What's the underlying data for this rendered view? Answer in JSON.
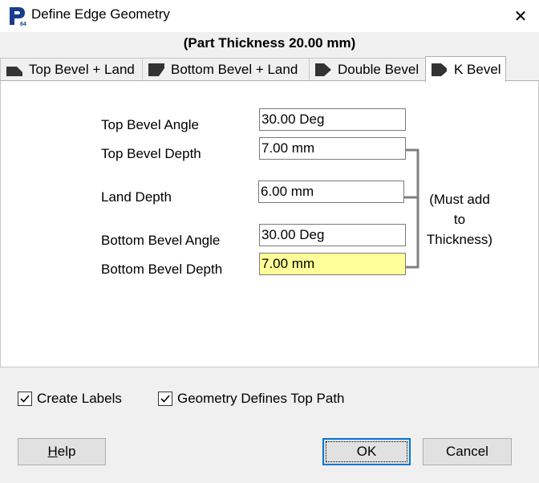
{
  "window": {
    "title": "Define Edge Geometry",
    "close_glyph": "✕",
    "app_icon": "p64-app-icon"
  },
  "header": {
    "part_thickness": "(Part Thickness 20.00 mm)"
  },
  "tabs": [
    {
      "label": "Top Bevel + Land",
      "icon": "top-bevel-land-icon",
      "active": false
    },
    {
      "label": "Bottom Bevel + Land",
      "icon": "bottom-bevel-land-icon",
      "active": false
    },
    {
      "label": "Double Bevel",
      "icon": "double-bevel-icon",
      "active": false
    },
    {
      "label": "K Bevel",
      "icon": "k-bevel-icon",
      "active": true
    }
  ],
  "form": {
    "top_bevel_angle": {
      "label": "Top Bevel Angle",
      "value": "30.00 Deg"
    },
    "top_bevel_depth": {
      "label": "Top Bevel Depth",
      "value": "7.00 mm"
    },
    "land_depth": {
      "label": "Land Depth",
      "value": "6.00 mm"
    },
    "bottom_bevel_angle": {
      "label": "Bottom Bevel Angle",
      "value": "30.00 Deg"
    },
    "bottom_bevel_depth": {
      "label": "Bottom Bevel Depth",
      "value": "7.00 mm",
      "highlight": "#ffff99"
    },
    "note_lines": [
      "(Must add",
      "to",
      "Thickness)"
    ]
  },
  "options": {
    "create_labels": {
      "label": "Create Labels",
      "checked": true
    },
    "geometry_defines_top_path": {
      "label": "Geometry Defines Top Path",
      "checked": true
    }
  },
  "buttons": {
    "help": {
      "mnemonic": "H",
      "rest": "elp"
    },
    "ok": "OK",
    "cancel": "Cancel"
  },
  "colors": {
    "accent": "#0078d7",
    "highlight": "#ffff99",
    "icon_blue": "#1a3c8f"
  }
}
